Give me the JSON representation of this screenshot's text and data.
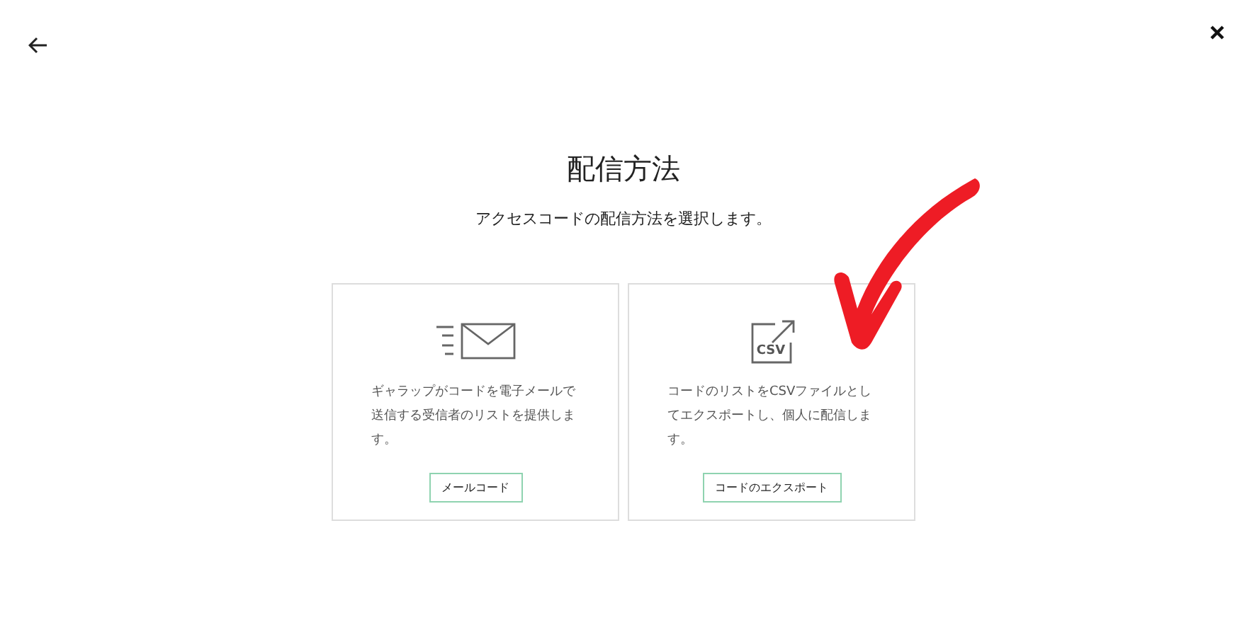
{
  "title": "配信方法",
  "subtitle": "アクセスコードの配信方法を選択します。",
  "options": [
    {
      "kind": "email",
      "description": "ギャラップがコードを電子メールで送信する受信者のリストを提供します。",
      "button": "メールコード"
    },
    {
      "kind": "csv",
      "icon_label": "CSV",
      "description": "コードのリストをCSVファイルとしてエクスポートし、個人に配信します。",
      "button": "コードのエクスポート"
    }
  ]
}
